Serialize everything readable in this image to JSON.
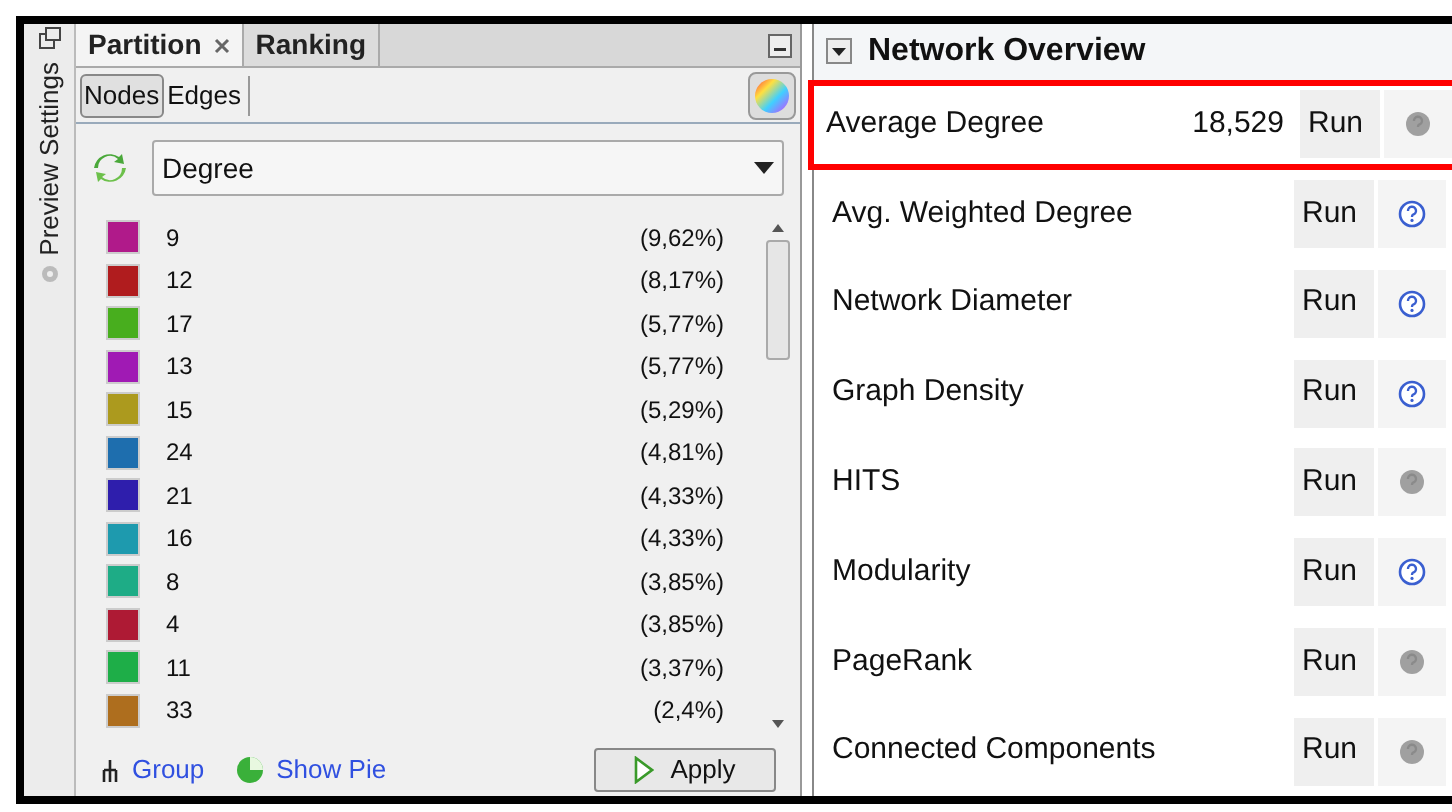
{
  "side_tab": {
    "label": "Preview Settings"
  },
  "tabs": [
    {
      "label": "Partition",
      "selected": true,
      "closable": true
    },
    {
      "label": "Ranking",
      "selected": false,
      "closable": false
    }
  ],
  "mode_toggle": [
    {
      "label": "Nodes",
      "selected": true
    },
    {
      "label": "Edges",
      "selected": false
    }
  ],
  "partition_select": {
    "value": "Degree"
  },
  "partitions": [
    {
      "label": "9",
      "share": "(9,62%)",
      "color": "#b01a8a"
    },
    {
      "label": "12",
      "share": "(8,17%)",
      "color": "#b01c1e"
    },
    {
      "label": "17",
      "share": "(5,77%)",
      "color": "#48ae1e"
    },
    {
      "label": "13",
      "share": "(5,77%)",
      "color": "#a01ab4"
    },
    {
      "label": "15",
      "share": "(5,29%)",
      "color": "#ac9a1e"
    },
    {
      "label": "24",
      "share": "(4,81%)",
      "color": "#1e6eae"
    },
    {
      "label": "21",
      "share": "(4,33%)",
      "color": "#2e1eac"
    },
    {
      "label": "16",
      "share": "(4,33%)",
      "color": "#1e9aae"
    },
    {
      "label": "8",
      "share": "(3,85%)",
      "color": "#1eac86"
    },
    {
      "label": "4",
      "share": "(3,85%)",
      "color": "#ae1a34"
    },
    {
      "label": "11",
      "share": "(3,37%)",
      "color": "#1eae48"
    },
    {
      "label": "33",
      "share": "(2,4%)",
      "color": "#ae6e1e"
    }
  ],
  "footer": {
    "group_link": "Group",
    "pie_link": "Show Pie",
    "apply_button": "Apply"
  },
  "statistics": {
    "title": "Network Overview",
    "rows": [
      {
        "name": "Average Degree",
        "result": "18,529",
        "button": "Run",
        "help_enabled": false,
        "highlighted": true
      },
      {
        "name": "Avg. Weighted Degree",
        "button": "Run",
        "help_enabled": true,
        "highlighted": false
      },
      {
        "name": "Network Diameter",
        "button": "Run",
        "help_enabled": true,
        "highlighted": false
      },
      {
        "name": "Graph Density",
        "button": "Run",
        "help_enabled": true,
        "highlighted": false
      },
      {
        "name": "HITS",
        "button": "Run",
        "help_enabled": false,
        "highlighted": false
      },
      {
        "name": "Modularity",
        "button": "Run",
        "help_enabled": true,
        "highlighted": false
      },
      {
        "name": "PageRank",
        "button": "Run",
        "help_enabled": false,
        "highlighted": false
      },
      {
        "name": "Connected Components",
        "button": "Run",
        "help_enabled": false,
        "highlighted": false
      }
    ]
  }
}
